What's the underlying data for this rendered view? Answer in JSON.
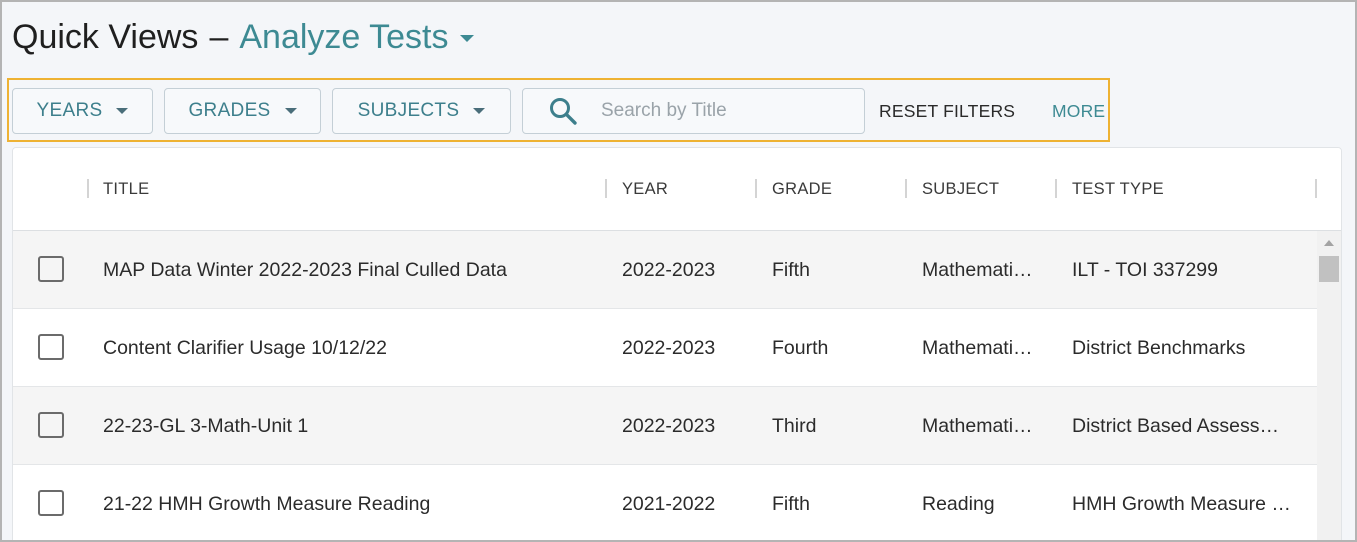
{
  "header": {
    "title": "Quick Views",
    "dash": "–",
    "view": "Analyze Tests"
  },
  "filters": {
    "years_label": "YEARS",
    "grades_label": "GRADES",
    "subjects_label": "SUBJECTS",
    "search_placeholder": "Search by Title",
    "search_value": "",
    "reset_label": "RESET FILTERS",
    "more_label": "MORE"
  },
  "table": {
    "columns": {
      "title": "TITLE",
      "year": "YEAR",
      "grade": "GRADE",
      "subject": "SUBJECT",
      "test_type": "TEST TYPE"
    },
    "rows": [
      {
        "title": "MAP Data Winter 2022-2023 Final Culled Data",
        "year": "2022-2023",
        "grade": "Fifth",
        "subject": "Mathemati…",
        "test_type": "ILT - TOI 337299"
      },
      {
        "title": "Content Clarifier Usage 10/12/22",
        "year": "2022-2023",
        "grade": "Fourth",
        "subject": "Mathemati…",
        "test_type": "District Benchmarks"
      },
      {
        "title": "22-23-GL 3-Math-Unit 1",
        "year": "2022-2023",
        "grade": "Third",
        "subject": "Mathemati…",
        "test_type": "District Based Assess…"
      },
      {
        "title": "21-22 HMH Growth Measure Reading",
        "year": "2021-2022",
        "grade": "Fifth",
        "subject": "Reading",
        "test_type": "HMH Growth Measure …"
      }
    ]
  },
  "colors": {
    "accent": "#3d8a93",
    "highlight_border": "#eeb233"
  },
  "icons": {
    "view_dropdown": "chevron-down-icon",
    "search": "search-icon",
    "checkbox": "checkbox-unchecked-icon"
  }
}
